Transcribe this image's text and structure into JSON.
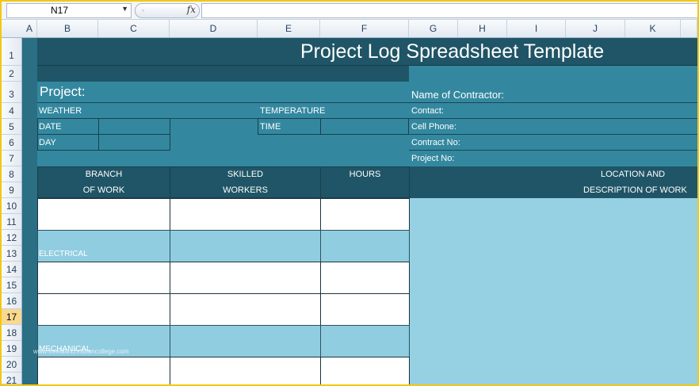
{
  "formula_bar": {
    "name_box": "N17",
    "fx_label": "fx",
    "formula": ""
  },
  "columns": [
    "A",
    "B",
    "C",
    "D",
    "E",
    "F",
    "G",
    "H",
    "I",
    "J",
    "K"
  ],
  "rows": [
    "1",
    "2",
    "3",
    "4",
    "5",
    "6",
    "7",
    "8",
    "9",
    "10",
    "11",
    "12",
    "13",
    "14",
    "15",
    "16",
    "17",
    "18",
    "19",
    "20",
    "21"
  ],
  "selected_row": "17",
  "sheet": {
    "title": "Project Log Spreadsheet Template",
    "project_label": "Project:",
    "weather_label": "WEATHER",
    "temperature_label": "TEMPERATURE",
    "date_label": "DATE",
    "time_label": "TIME",
    "day_label": "DAY",
    "contractor_label": "Name of Contractor:",
    "contact_label": "Contact:",
    "cell_phone_label": "Cell Phone:",
    "contract_no_label": "Contract No:",
    "project_no_label": "Project No:",
    "col_branch_1": "BRANCH",
    "col_branch_2": "OF WORK",
    "col_skilled_1": "SKILLED",
    "col_skilled_2": "WORKERS",
    "col_hours": "HOURS",
    "col_location_1": "LOCATION AND",
    "col_location_2": "DESCRIPTION OF WORK",
    "branch_electrical": "ELECTRICAL",
    "branch_mechanical": "MECHANICAL"
  },
  "watermark": "www.freefaithchristiancollege.com",
  "colors": {
    "sheet_teal": "#2a6f84",
    "header_dark": "#1f5566",
    "info_teal": "#33889f",
    "light_blue": "#91cde0",
    "selected_row": "#f9d890"
  }
}
